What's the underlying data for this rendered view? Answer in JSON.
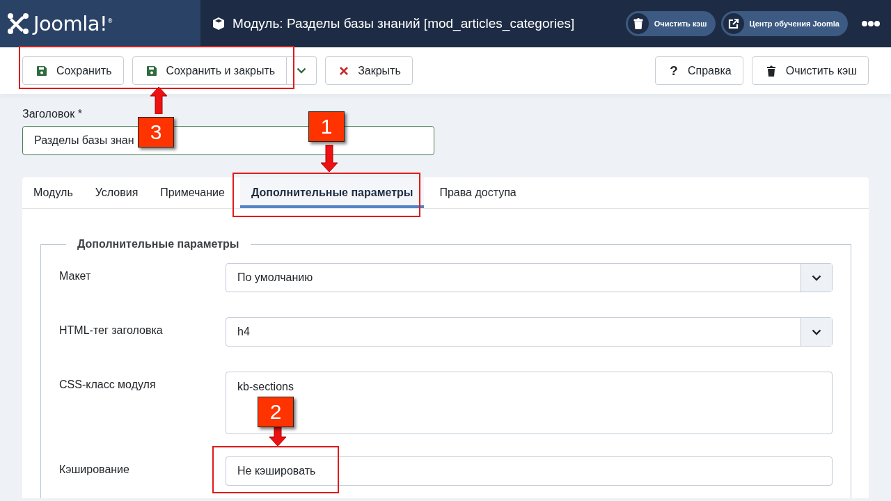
{
  "header": {
    "logo": "Joomla!$^{®}$",
    "title": "Модуль: Разделы базы знаний [mod_articles_categories]",
    "buttons": [
      {
        "kind": "trash",
        "label": "Очистить кэш"
      },
      {
        "kind": "external",
        "label": "Центр обучения Joomla"
      }
    ]
  },
  "toolbar": {
    "left": [
      {
        "kind": "save",
        "label": "Сохранить"
      },
      {
        "kind": "save-split",
        "label": "Сохранить и закрыть"
      },
      {
        "kind": "close",
        "label": "Закрыть"
      }
    ],
    "right": [
      {
        "kind": "help",
        "glyph": "?",
        "label": "Справка"
      },
      {
        "kind": "trash",
        "label": "Очистить кэш"
      }
    ]
  },
  "title_field": {
    "label": "Заголовок *",
    "value": "Разделы базы знан"
  },
  "tabs": [
    {
      "label": "Модуль",
      "selected": false
    },
    {
      "label": "Условия",
      "selected": false
    },
    {
      "label": "Примечание",
      "selected": false
    },
    {
      "label": "Дополнительные параметры",
      "selected": true
    },
    {
      "label": "Права доступа",
      "selected": false
    }
  ],
  "fieldset": {
    "legend": "Дополнительные параметры",
    "fields": [
      {
        "kind": "select",
        "label": "Макет",
        "value": "По умолчанию"
      },
      {
        "kind": "select",
        "label": "HTML-тег заголовка",
        "value": "h4"
      },
      {
        "kind": "textarea",
        "label": "CSS-класс модуля",
        "value": "kb-sections"
      },
      {
        "kind": "plain",
        "label": "Кэширование",
        "value": "Не кэшировать"
      }
    ]
  },
  "annotations": [
    {
      "label": "3"
    },
    {
      "label": "1"
    },
    {
      "label": "2"
    }
  ]
}
